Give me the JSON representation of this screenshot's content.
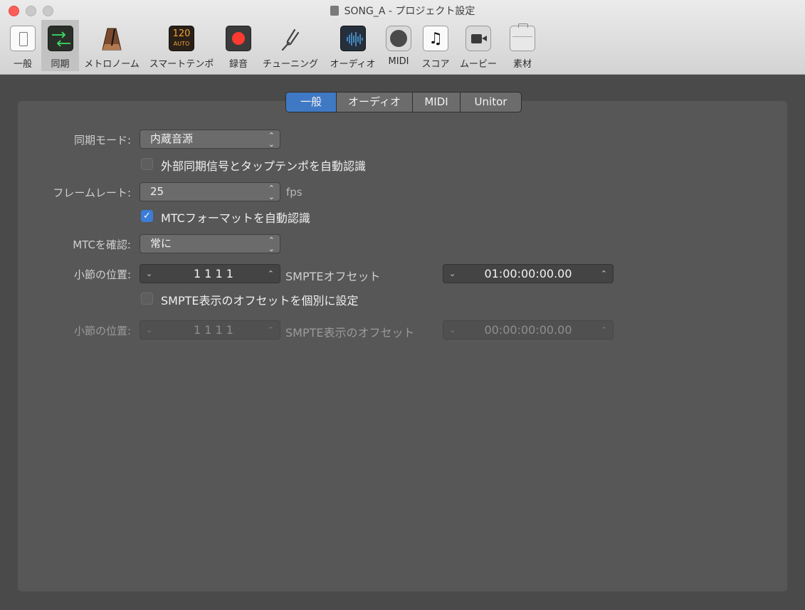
{
  "window": {
    "title": "SONG_A - プロジェクト設定"
  },
  "toolbar": {
    "items": [
      {
        "label": "一般"
      },
      {
        "label": "同期"
      },
      {
        "label": "メトロノーム"
      },
      {
        "label": "スマートテンポ",
        "icon_text_top": "120",
        "icon_text_bottom": "AUTO"
      },
      {
        "label": "録音"
      },
      {
        "label": "チューニング"
      },
      {
        "label": "オーディオ"
      },
      {
        "label": "MIDI"
      },
      {
        "label": "スコア"
      },
      {
        "label": "ムービー"
      },
      {
        "label": "素材"
      }
    ],
    "selected": "同期"
  },
  "tabs": {
    "items": [
      {
        "label": "一般"
      },
      {
        "label": "オーディオ"
      },
      {
        "label": "MIDI"
      },
      {
        "label": "Unitor"
      }
    ],
    "active": "一般"
  },
  "form": {
    "sync_mode": {
      "label": "同期モード:",
      "value": "内蔵音源"
    },
    "auto_detect_external": {
      "label": "外部同期信号とタップテンポを自動認識",
      "checked": false
    },
    "frame_rate": {
      "label": "フレームレート:",
      "value": "25",
      "unit": "fps"
    },
    "auto_detect_mtc": {
      "label": "MTCフォーマットを自動認識",
      "checked": true
    },
    "verify_mtc": {
      "label": "MTCを確認:",
      "value": "常に"
    },
    "bar_position_1": {
      "label": "小節の位置:",
      "value": "1 1 1     1"
    },
    "smpte_offset": {
      "label": "SMPTEオフセット",
      "value": "01:00:00:00.00"
    },
    "separate_display_offset": {
      "label": "SMPTE表示のオフセットを個別に設定",
      "checked": false
    },
    "bar_position_2": {
      "label": "小節の位置:",
      "value": "1 1 1     1"
    },
    "smpte_display_offset": {
      "label": "SMPTE表示のオフセット",
      "value": "00:00:00:00.00"
    }
  }
}
